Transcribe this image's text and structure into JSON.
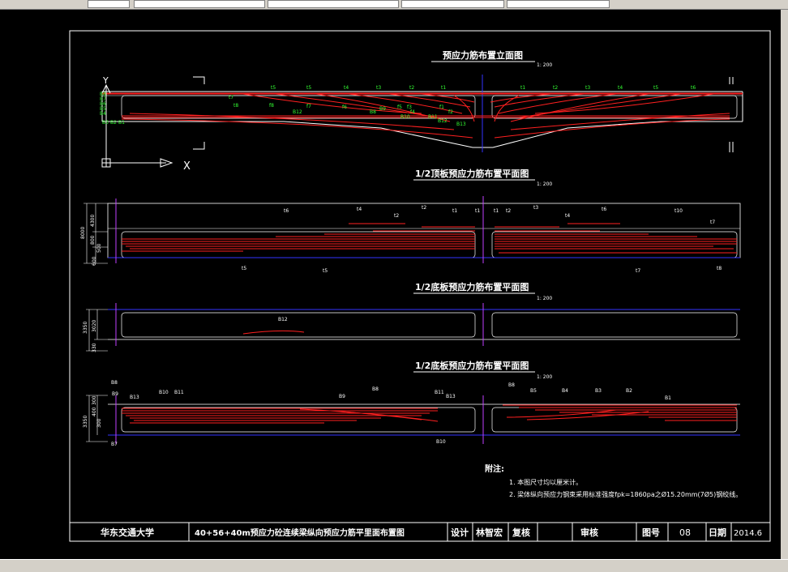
{
  "drawing": {
    "views": {
      "elevation": {
        "title": "预应力筋布置立面图",
        "scale": "1: 200"
      },
      "top_slab": {
        "title": "1/2顶板预应力筋布置平面图",
        "scale": "1: 200"
      },
      "web": {
        "title": "1/2底板预应力筋布置平面图",
        "scale": "1: 200"
      },
      "bottom_slab": {
        "title": "1/2底板预应力筋布置平面图",
        "scale": "1: 200"
      }
    },
    "axis": {
      "y": "Y",
      "x": "X"
    },
    "elevation_labels_top": [
      "t5",
      "t5",
      "t4",
      "t3",
      "t2",
      "t1",
      "t1",
      "t2",
      "t3",
      "t4",
      "t5",
      "t6"
    ],
    "elevation_labels_left": [
      "B8",
      "B7",
      "B6",
      "B5",
      "B4",
      "B3",
      "B2",
      "B1"
    ],
    "elevation_labels_mid": [
      "t7",
      "t8",
      "f8",
      "B12",
      "f7",
      "f6",
      "B8",
      "B9",
      "B10",
      "f5",
      "f4",
      "f3",
      "f2",
      "f1",
      "B11",
      "B12",
      "B13"
    ],
    "top_slab_labels": [
      "t6",
      "t4",
      "t2",
      "t2",
      "t1",
      "t1",
      "t1",
      "t2",
      "t3",
      "t4",
      "t6",
      "t10",
      "t7",
      "t5",
      "t5",
      "t7",
      "t8"
    ],
    "top_slab_dims": [
      "8000",
      "4300",
      "800",
      "500",
      "600"
    ],
    "web_labels": [
      "B12"
    ],
    "web_dims": [
      "3350",
      "3020",
      "330"
    ],
    "bottom_slab_labels": [
      "B8",
      "B9",
      "B13",
      "B10",
      "B11",
      "B9",
      "B8",
      "B11",
      "B13",
      "B8",
      "B5",
      "B4",
      "B3",
      "B2",
      "B1",
      "B7",
      "B10"
    ],
    "bottom_slab_dims": [
      "3350",
      "300",
      "400",
      "300"
    ],
    "notes": {
      "header": "附注:",
      "items": [
        "1. 本图尺寸均以厘米计。",
        "2. 梁体纵向预应力钢束采用标准强度fpk=1860pa之Ø15.20mm(7Ø5)钢绞线。"
      ]
    }
  },
  "title_block": {
    "school": "华东交通大学",
    "project": "40+56+40m预应力砼连续梁纵向预应力筋平里面布置图",
    "design_label": "设计",
    "designer": "林智宏",
    "review_label": "复核",
    "approve_label": "审核",
    "drawing_no_label": "图号",
    "drawing_no": "08",
    "date_label": "日期",
    "date": "2014.6"
  },
  "colors": {
    "background": "#000000",
    "frame": "#ffffff",
    "tendon": "#ff2020",
    "label": "#33ff33",
    "centerline": "#3333ff",
    "section_line": "#c040ff"
  }
}
